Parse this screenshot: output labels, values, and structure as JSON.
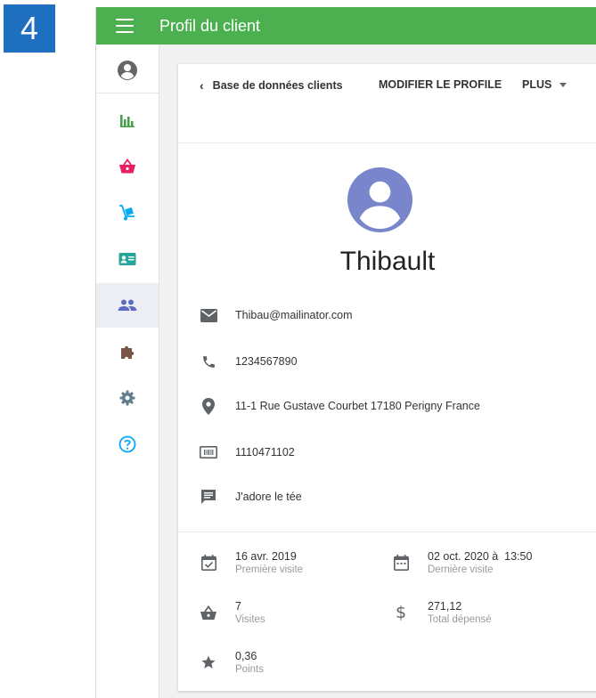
{
  "step_badge": "4",
  "header": {
    "title": "Profil du client"
  },
  "sidebar": {
    "items": [
      {
        "name": "account-icon",
        "color": "#666666"
      },
      {
        "name": "bar-chart-icon",
        "color": "#43a047"
      },
      {
        "name": "basket-icon",
        "color": "#e91e63"
      },
      {
        "name": "hand-truck-icon",
        "color": "#03a9f4"
      },
      {
        "name": "id-card-icon",
        "color": "#26a69a"
      },
      {
        "name": "people-icon",
        "color": "#5c6bc0",
        "active": true
      },
      {
        "name": "puzzle-icon",
        "color": "#795548"
      },
      {
        "name": "gear-icon",
        "color": "#607d8b"
      },
      {
        "name": "help-icon",
        "color": "#03a9f4"
      }
    ]
  },
  "toolbar": {
    "back_label": "Base de données clients",
    "edit_label": "MODIFIER LE PROFILE",
    "more_label": "PLUS"
  },
  "customer": {
    "name": "Thibault",
    "email": "Thibau@mailinator.com",
    "phone": "1234567890",
    "address": "11-1 Rue Gustave Courbet 17180 Perigny France",
    "code": "1110471102",
    "note": "J'adore le tée"
  },
  "stats": {
    "first_visit": {
      "value": "16 avr. 2019",
      "label": "Première visite"
    },
    "last_visit": {
      "value": "02 oct. 2020 à  13:50",
      "label": "Dernière visite"
    },
    "visits": {
      "value": "7",
      "label": "Visites"
    },
    "total_spent": {
      "value": "271,12",
      "label": "Total dépensé"
    },
    "points": {
      "value": "0,36",
      "label": "Points"
    }
  },
  "colors": {
    "header": "#4caf50",
    "avatar": "#7986cb",
    "badge": "#1e6fc0",
    "icon_gray": "#5f6368"
  }
}
